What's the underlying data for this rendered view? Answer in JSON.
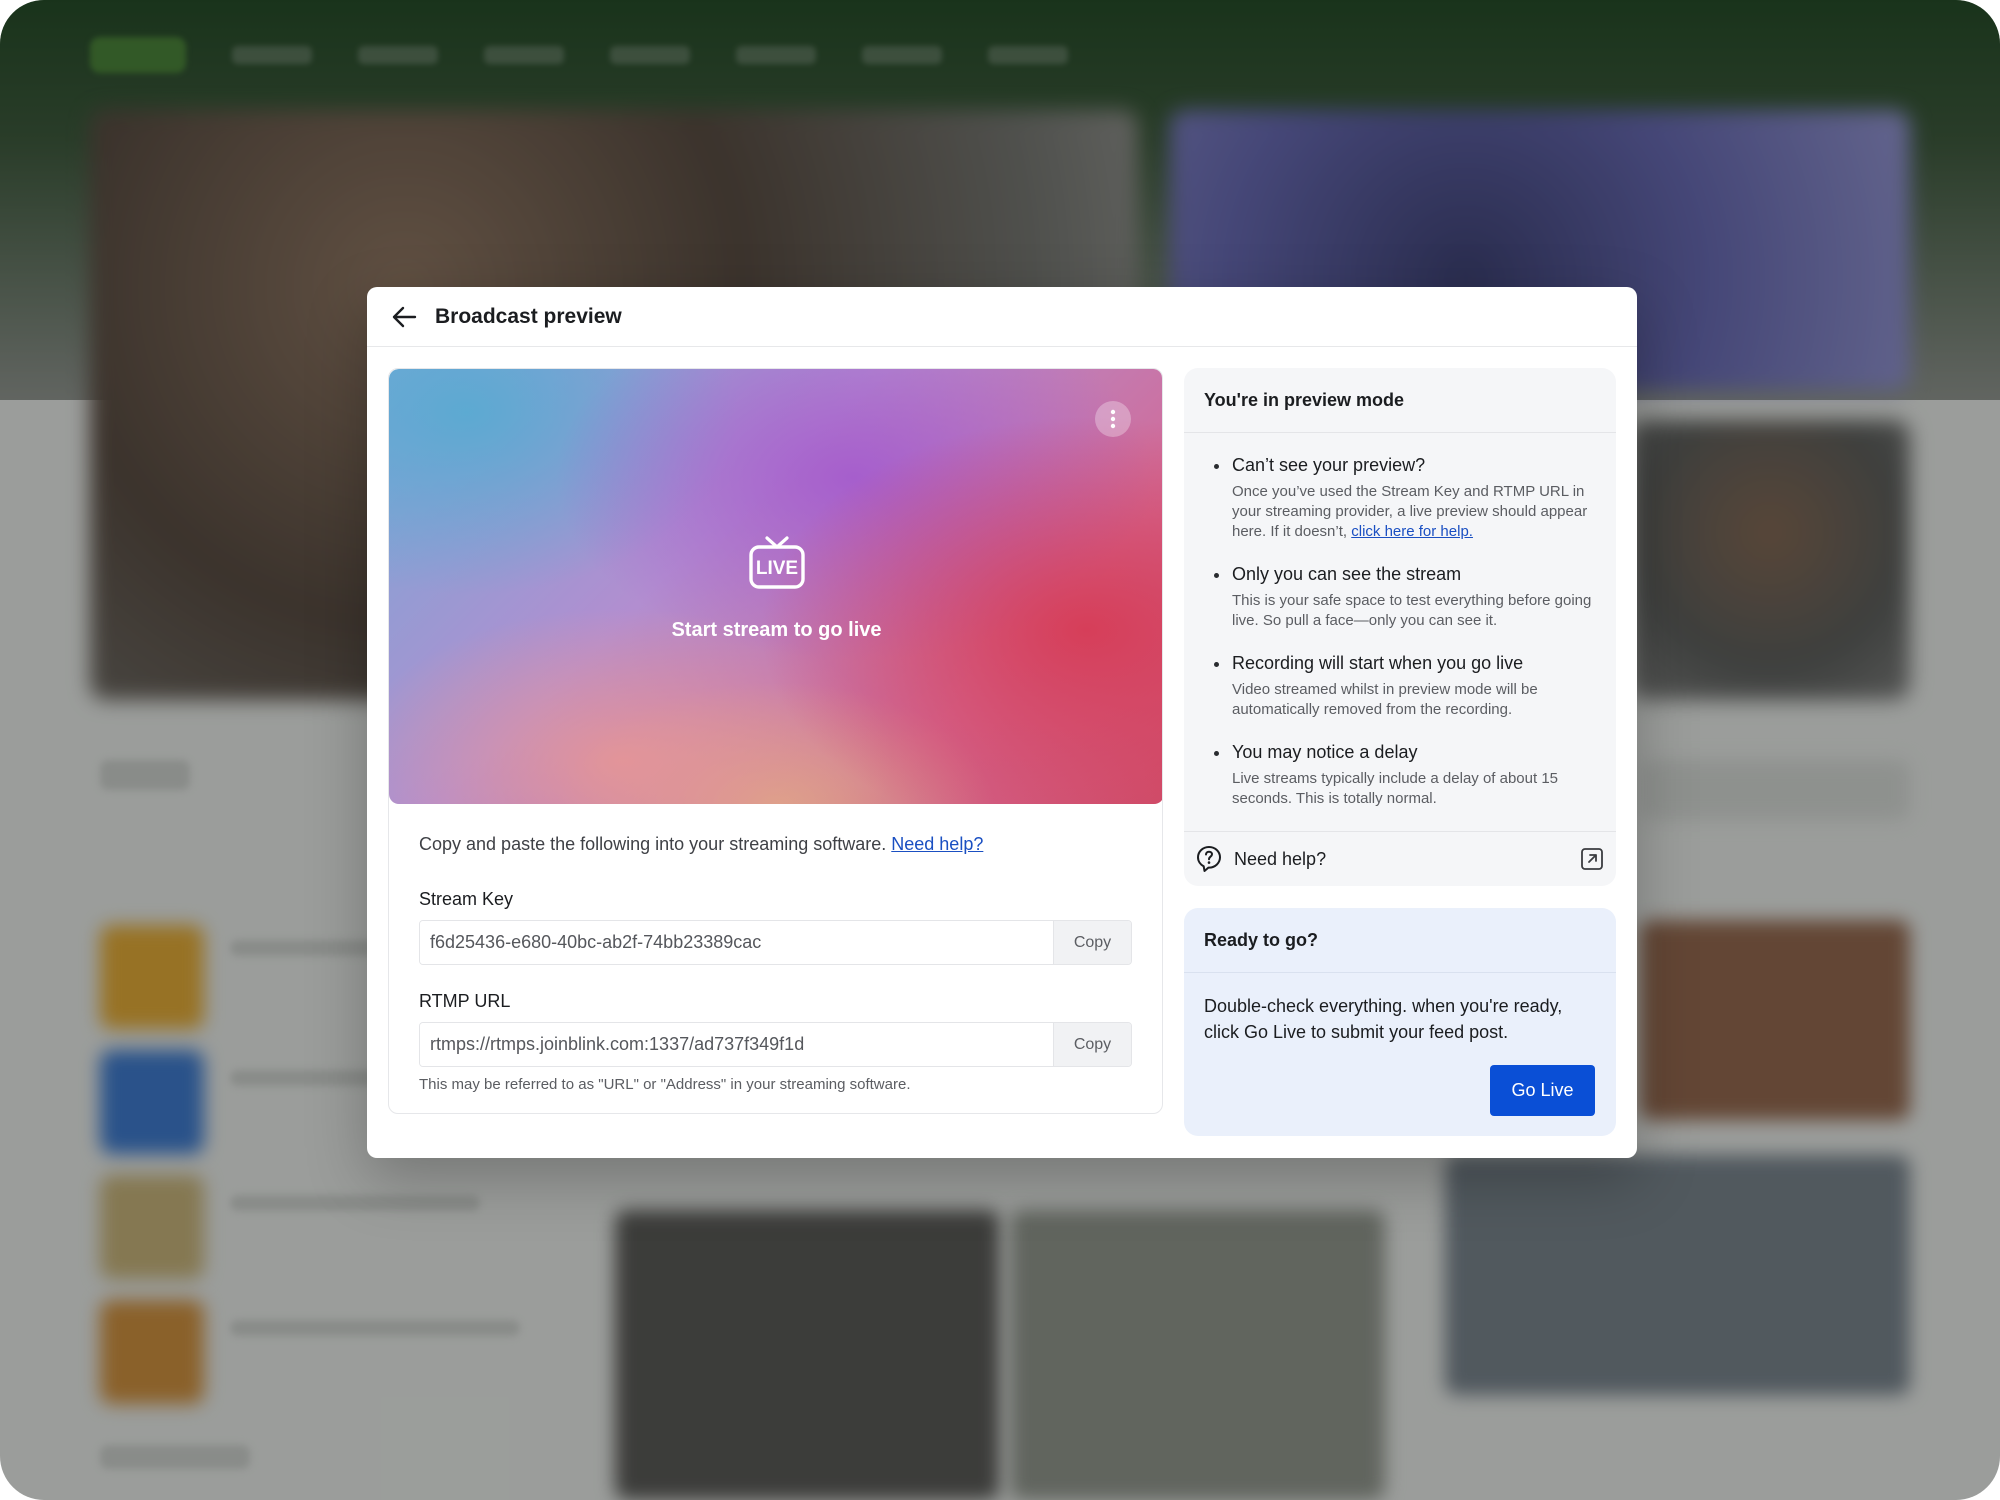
{
  "background": {
    "brand_color": "#0f3a12"
  },
  "modal": {
    "title": "Broadcast preview",
    "back_icon": "arrow-left-icon",
    "preview": {
      "status_text": "Start stream to go live",
      "badge_text": "LIVE",
      "menu_icon": "more-vertical-icon",
      "live_icon": "live-tv-icon"
    },
    "instructions": {
      "text": "Copy and paste the following into your streaming software.",
      "help_link": "Need help?"
    },
    "stream_key": {
      "label": "Stream Key",
      "value": "f6d25436-e680-40bc-ab2f-74bb23389cac",
      "copy_label": "Copy"
    },
    "rtmp_url": {
      "label": "RTMP URL",
      "value": "rtmps://rtmps.joinblink.com:1337/ad737f349f1d",
      "copy_label": "Copy",
      "hint": "This may be referred to as \"URL\" or \"Address\" in your streaming software."
    },
    "preview_info": {
      "title": "You're in preview mode",
      "tips": [
        {
          "title": "Can’t see your preview?",
          "body": "Once you’ve used the Stream Key and RTMP URL in your streaming provider, a live preview should appear here. If it doesn’t,",
          "link": "click here for help."
        },
        {
          "title": "Only you can see the stream",
          "body": "This is your safe space to test everything before going live. So pull a face—only you can see it."
        },
        {
          "title": "Recording will start when you go live",
          "body": "Video streamed whilst in preview mode will be automatically removed from the recording."
        },
        {
          "title": "You may notice a delay",
          "body": "Live streams typically include a delay of about 15 seconds. This is totally normal."
        }
      ],
      "help_label": "Need help?",
      "help_icon": "question-bubble-icon",
      "external_icon": "external-link-icon"
    },
    "ready": {
      "title": "Ready to go?",
      "text": "Double-check everything. when you're ready, click Go Live to submit your feed post.",
      "button_label": "Go Live",
      "button_color": "#0a4fd6"
    }
  }
}
